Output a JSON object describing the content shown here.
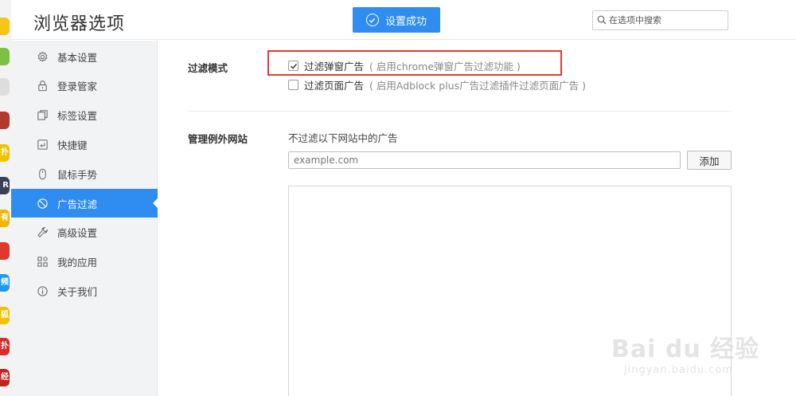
{
  "header": {
    "title": "浏览器选项",
    "toast_text": "设置成功",
    "search_placeholder": "在选项中搜索"
  },
  "sidebar": {
    "items": [
      {
        "label": "基本设置",
        "icon": "gear-icon"
      },
      {
        "label": "登录管家",
        "icon": "lock-icon"
      },
      {
        "label": "标签设置",
        "icon": "tabs-icon"
      },
      {
        "label": "快捷键",
        "icon": "keyboard-icon"
      },
      {
        "label": "鼠标手势",
        "icon": "mouse-icon"
      },
      {
        "label": "广告过滤",
        "icon": "block-icon",
        "active": true
      },
      {
        "label": "高级设置",
        "icon": "wrench-icon"
      },
      {
        "label": "我的应用",
        "icon": "apps-icon"
      },
      {
        "label": "关于我们",
        "icon": "info-icon"
      }
    ]
  },
  "filter_mode": {
    "label": "过滤模式",
    "options": [
      {
        "label": "过滤弹窗广告",
        "note": "( 启用chrome弹窗广告过滤功能 )",
        "checked": true
      },
      {
        "label": "过滤页面广告",
        "note": "( 启用Adblock plus广告过滤插件过滤页面广告 )",
        "checked": false
      }
    ]
  },
  "exceptions": {
    "label": "管理例外网站",
    "description": "不过滤以下网站中的广告",
    "input_placeholder": "example.com",
    "add_label": "添加"
  },
  "taskbar_icons": [
    {
      "glyph": "",
      "color": "#f5c518"
    },
    {
      "glyph": "",
      "color": "#7cc242"
    },
    {
      "glyph": "",
      "color": "#dddddd"
    },
    {
      "glyph": "",
      "color": "#b23a2a"
    },
    {
      "glyph": "扑",
      "color": "#f2c200"
    },
    {
      "glyph": "R",
      "color": "#3a3f5c"
    },
    {
      "glyph": "有",
      "color": "#f2b600"
    },
    {
      "glyph": "",
      "color": "#e0382e"
    },
    {
      "glyph": "频",
      "color": "#1e9be8"
    },
    {
      "glyph": "狐",
      "color": "#f2c200"
    },
    {
      "glyph": "扑",
      "color": "#d82c2c"
    },
    {
      "glyph": "经",
      "color": "#c0251f"
    }
  ],
  "watermark": {
    "main": "Bai du 经验",
    "sub": "jingyan.baidu.com"
  },
  "colors": {
    "accent": "#2f8cf0",
    "highlight_border": "#e53935"
  }
}
